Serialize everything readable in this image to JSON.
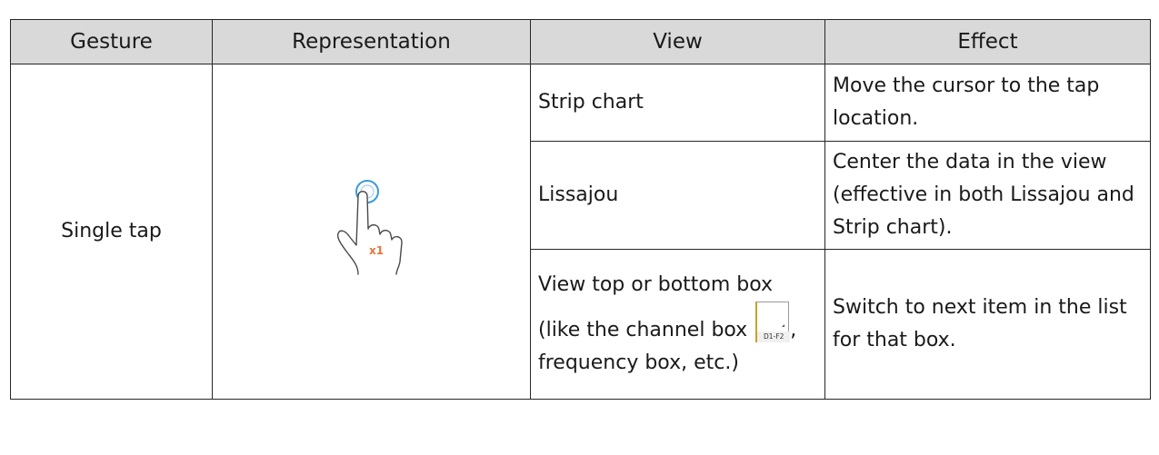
{
  "table": {
    "headers": [
      "Gesture",
      "Representation",
      "View",
      "Effect"
    ],
    "gesture": "Single tap",
    "representation": {
      "icon": "single-tap-hand-icon",
      "tap_count_label": "x1",
      "accent_color": "#e8743b",
      "ring_color": "#3a9ad9"
    },
    "rows": [
      {
        "view": "Strip chart",
        "effect": "Move the cursor to the tap location."
      },
      {
        "view": "Lissajou",
        "effect": "Center the data in the view (effective in both Lissajou and Strip chart)."
      },
      {
        "view_before_icon": "View top or bottom box (like the channel box ",
        "view_icon": "channel-box-icon",
        "view_icon_label": "D1-F2",
        "view_after_icon": ", frequency box, etc.)",
        "effect": "Switch to next item in the list for that box."
      }
    ]
  }
}
